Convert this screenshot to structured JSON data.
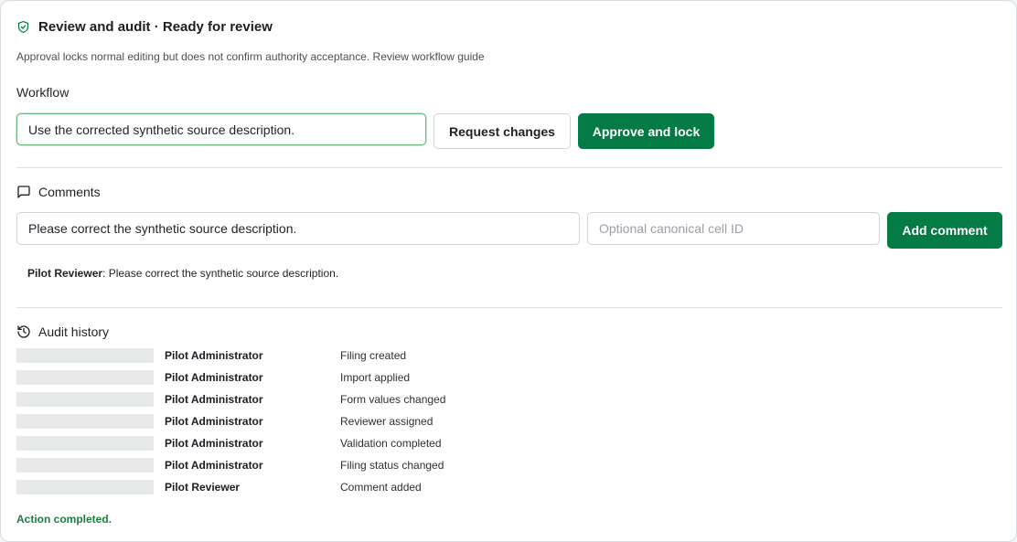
{
  "header": {
    "title": "Review and audit · Ready for review",
    "notice": "Approval locks normal editing but does not confirm authority acceptance. Review workflow guide",
    "icon": "shield-check-icon",
    "accent_color": "#047a45"
  },
  "workflow": {
    "label": "Workflow",
    "note_value": "Use the corrected synthetic source description.",
    "request_changes_label": "Request changes",
    "approve_label": "Approve and lock"
  },
  "comments": {
    "heading": "Comments",
    "icon": "message-square-icon",
    "comment_value": "Please correct the synthetic source description.",
    "cell_placeholder": "Optional canonical cell ID",
    "add_label": "Add comment",
    "items": [
      {
        "author": "Pilot Reviewer",
        "text": ": Please correct the synthetic source description."
      }
    ]
  },
  "audit": {
    "heading": "Audit history",
    "icon": "history-icon",
    "rows": [
      {
        "actor": "Pilot Administrator",
        "action": "Filing created"
      },
      {
        "actor": "Pilot Administrator",
        "action": "Import applied"
      },
      {
        "actor": "Pilot Administrator",
        "action": "Form values changed"
      },
      {
        "actor": "Pilot Administrator",
        "action": "Reviewer assigned"
      },
      {
        "actor": "Pilot Administrator",
        "action": "Validation completed"
      },
      {
        "actor": "Pilot Administrator",
        "action": "Filing status changed"
      },
      {
        "actor": "Pilot Reviewer",
        "action": "Comment added"
      }
    ]
  },
  "status": {
    "message": "Action completed.",
    "color": "#1b7f3f"
  }
}
